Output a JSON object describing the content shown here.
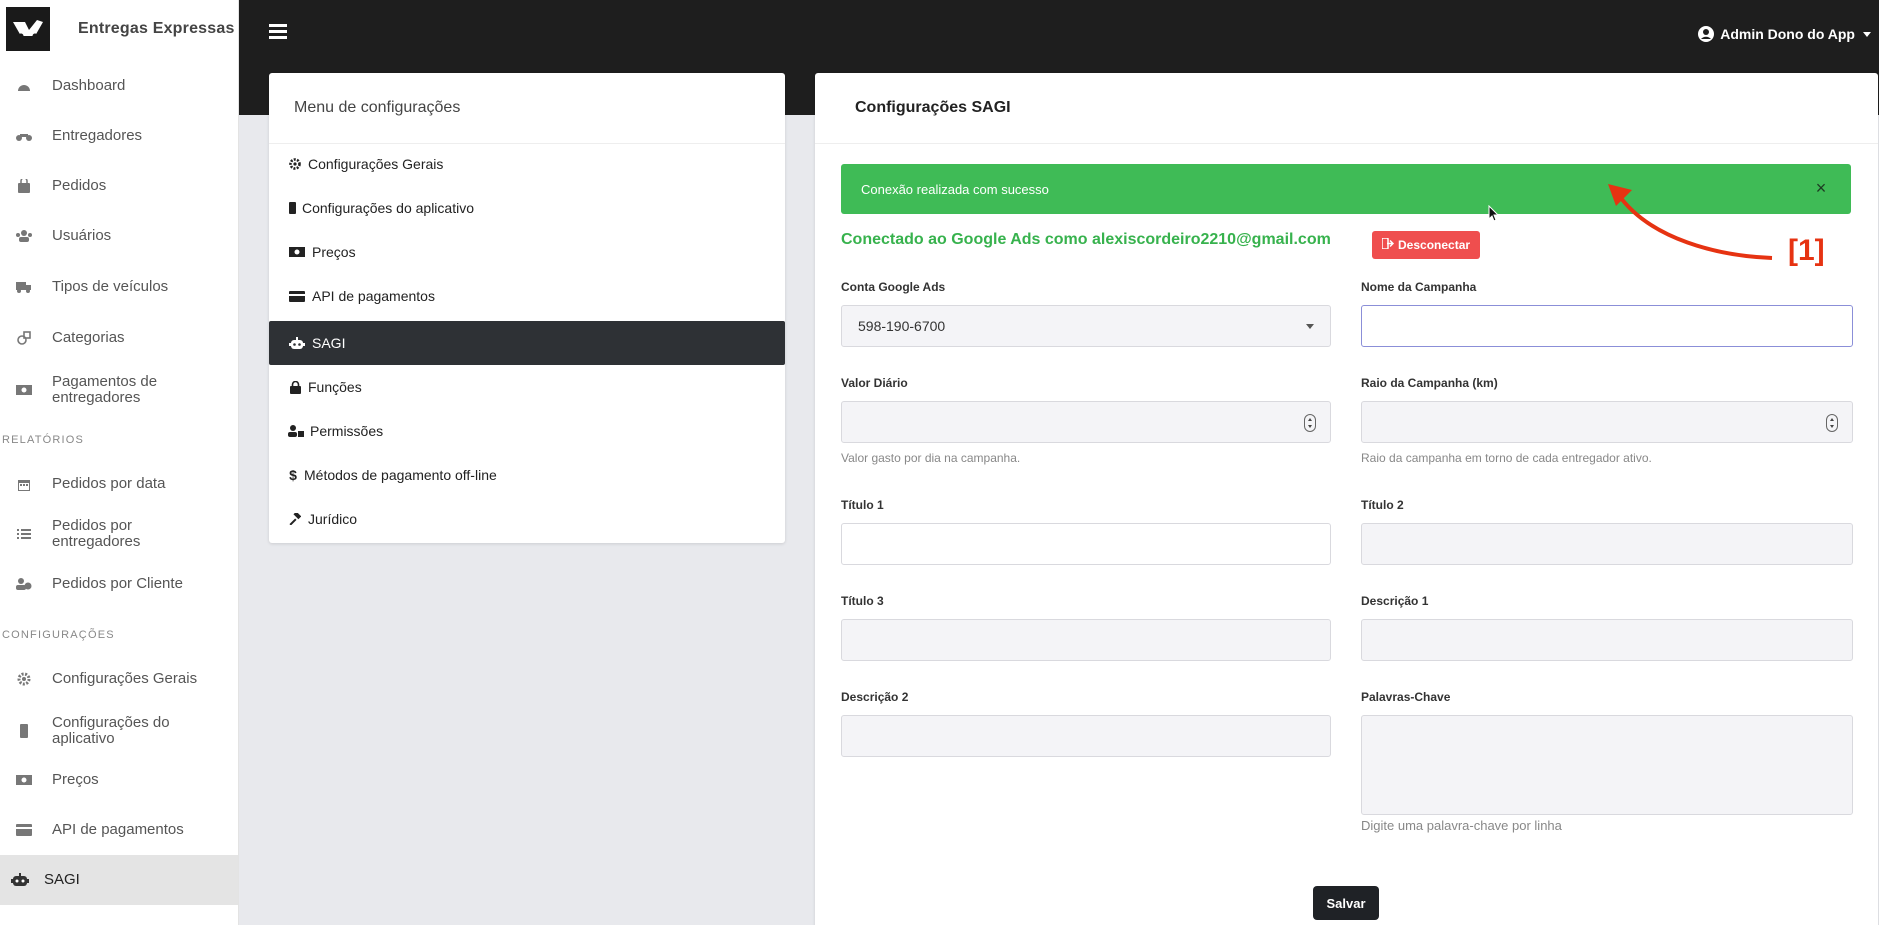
{
  "app": {
    "brand_name": "Entregas Expressas",
    "user_label": "Admin Dono do App"
  },
  "sidebar": {
    "items": [
      {
        "label": "Dashboard",
        "icon": "gauge-icon"
      },
      {
        "label": "Entregadores",
        "icon": "motorcycle-icon"
      },
      {
        "label": "Pedidos",
        "icon": "bag-icon"
      },
      {
        "label": "Usuários",
        "icon": "users-icon"
      },
      {
        "label": "Tipos de veículos",
        "icon": "truck-icon"
      },
      {
        "label": "Categorias",
        "icon": "shapes-icon"
      },
      {
        "label": "Pagamentos de entregadores",
        "icon": "money-icon"
      }
    ],
    "section_reports": "RELATÓRIOS",
    "reports": [
      {
        "label": "Pedidos por data",
        "icon": "calendar-icon"
      },
      {
        "label": "Pedidos por entregadores",
        "icon": "list-icon"
      },
      {
        "label": "Pedidos por Cliente",
        "icon": "user-clock-icon"
      }
    ],
    "section_settings": "CONFIGURAÇÕES",
    "settings": [
      {
        "label": "Configurações Gerais",
        "icon": "gear-icon"
      },
      {
        "label": "Configurações do aplicativo",
        "icon": "phone-icon"
      },
      {
        "label": "Preços",
        "icon": "money-icon"
      },
      {
        "label": "API de pagamentos",
        "icon": "card-icon"
      },
      {
        "label": "SAGI",
        "icon": "robot-icon"
      }
    ]
  },
  "config_menu": {
    "title": "Menu de configurações",
    "items": [
      {
        "label": "Configurações Gerais",
        "icon": "gear-icon"
      },
      {
        "label": "Configurações do aplicativo",
        "icon": "phone-icon"
      },
      {
        "label": "Preços",
        "icon": "money-icon"
      },
      {
        "label": "API de pagamentos",
        "icon": "card-icon"
      },
      {
        "label": "SAGI",
        "icon": "robot-icon"
      },
      {
        "label": "Funções",
        "icon": "lock-icon"
      },
      {
        "label": "Permissões",
        "icon": "user-lock-icon"
      },
      {
        "label": "Métodos de pagamento off-line",
        "icon": "dollar-icon"
      },
      {
        "label": "Jurídico",
        "icon": "gavel-icon"
      }
    ],
    "active_index": 4
  },
  "sagi": {
    "title": "Configurações SAGI",
    "alert_text": "Conexão realizada com sucesso",
    "alert_close": "×",
    "connected_text": "Conectado ao Google Ads como alexiscordeiro2210@gmail.com",
    "disconnect_label": "Desconectar",
    "fields": {
      "ads_account_label": "Conta Google Ads",
      "ads_account_value": "598-190-6700",
      "campaign_name_label": "Nome da Campanha",
      "daily_value_label": "Valor Diário",
      "daily_value_help": "Valor gasto por dia na campanha.",
      "radius_label": "Raio da Campanha (km)",
      "radius_help": "Raio da campanha em torno de cada entregador ativo.",
      "title1_label": "Título 1",
      "title2_label": "Título 2",
      "title3_label": "Título 3",
      "desc1_label": "Descrição 1",
      "desc2_label": "Descrição 2",
      "keywords_label": "Palavras-Chave",
      "keywords_help": "Digite uma palavra-chave por linha"
    },
    "save_label": "Salvar"
  },
  "annotation": {
    "label": "[1]",
    "color": "#e63312"
  },
  "colors": {
    "topbar": "#1e1e1e",
    "success": "#3fbb56",
    "danger": "#ef4e4e",
    "active_menu": "#2e3135"
  }
}
